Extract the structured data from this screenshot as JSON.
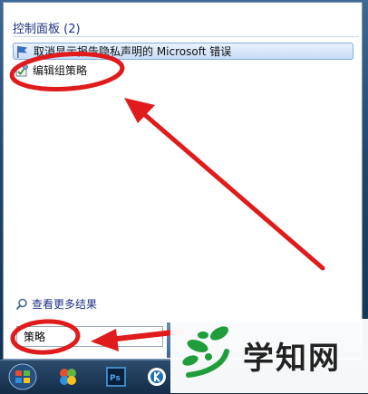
{
  "start_menu": {
    "section_title": "控制面板 (2)",
    "results": [
      {
        "label": "取消显示报告隐私声明的 Microsoft 错误",
        "icon": "flag-icon",
        "selected": true
      },
      {
        "label": "编辑组策略",
        "icon": "group-policy-icon",
        "selected": false
      }
    ],
    "see_more_label": "查看更多结果",
    "search_value": "策略"
  },
  "watermark": {
    "text": "学知网"
  },
  "colors": {
    "highlight": "#c6dcf7",
    "annotation_red": "#e01b1b",
    "section_title": "#1e3287",
    "watermark_green": "#1f9d3a"
  }
}
